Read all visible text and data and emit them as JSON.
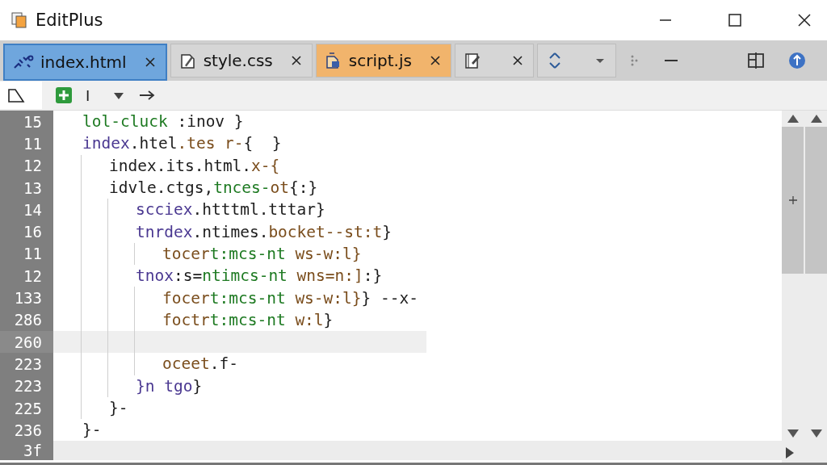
{
  "window": {
    "title": "EditPlus"
  },
  "tabs": [
    {
      "label": "index.html",
      "selected": true,
      "closable": true,
      "color": "#6fa6dd"
    },
    {
      "label": "style.css",
      "selected": false,
      "closable": true,
      "color": "#d6d6d6"
    },
    {
      "label": "script.js",
      "selected": false,
      "closable": true,
      "color": "#f1b46c"
    },
    {
      "selected": false,
      "closable": true,
      "color": "#d6d6d6"
    },
    {
      "selected": false,
      "closable": false,
      "color": "#d6d6d6"
    }
  ],
  "toolbar": {
    "cursor_text": "I"
  },
  "lines": [
    {
      "number": "15",
      "tokens": [
        {
          "text": "lol-cluck ",
          "kind": "value"
        },
        {
          "text": ":inov }",
          "kind": "plain"
        }
      ]
    },
    {
      "number": "11",
      "tokens": [
        {
          "text": "index",
          "kind": "tag"
        },
        {
          "text": ".htel",
          "kind": "plain"
        },
        {
          "text": ".tes r-",
          "kind": "attr"
        },
        {
          "text": "{  }",
          "kind": "plain"
        }
      ],
      "children": [
        {
          "number": "12",
          "tokens": [
            {
              "text": "index.its.html.",
              "kind": "plain"
            },
            {
              "text": "x-{",
              "kind": "attr"
            }
          ]
        },
        {
          "number": "13",
          "tokens": [
            {
              "text": "idvle.ctgs,",
              "kind": "plain"
            },
            {
              "text": "tnces-",
              "kind": "value"
            },
            {
              "text": "ot",
              "kind": "attr"
            },
            {
              "text": "{:}",
              "kind": "plain"
            }
          ],
          "children": [
            {
              "number": "14",
              "tokens": [
                {
                  "text": "scciex",
                  "kind": "tag"
                },
                {
                  "text": ".htttml.tttar}",
                  "kind": "plain"
                }
              ]
            },
            {
              "number": "16",
              "tokens": [
                {
                  "text": "tnrdex",
                  "kind": "tag"
                },
                {
                  "text": ".ntimes.",
                  "kind": "plain"
                },
                {
                  "text": "bocket--st:t",
                  "kind": "attr"
                },
                {
                  "text": "}",
                  "kind": "plain"
                }
              ],
              "children": [
                {
                  "number": "11",
                  "tokens": [
                    {
                      "text": "tocer",
                      "kind": "attr"
                    },
                    {
                      "text": "t:mcs-nt ",
                      "kind": "value"
                    },
                    {
                      "text": "ws-w:l}",
                      "kind": "attr"
                    }
                  ]
                }
              ]
            },
            {
              "number": "12",
              "tokens": [
                {
                  "text": "tnox",
                  "kind": "tag"
                },
                {
                  "text": ":s=",
                  "kind": "plain"
                },
                {
                  "text": "ntimcs-nt ",
                  "kind": "value"
                },
                {
                  "text": "wns=n:]",
                  "kind": "attr"
                },
                {
                  "text": ":}",
                  "kind": "plain"
                }
              ],
              "children": [
                {
                  "number": "133",
                  "tokens": [
                    {
                      "text": "focer",
                      "kind": "attr"
                    },
                    {
                      "text": "t:mcs-nt ",
                      "kind": "value"
                    },
                    {
                      "text": "ws-w:l}",
                      "kind": "attr"
                    },
                    {
                      "text": "} --x-",
                      "kind": "plain"
                    }
                  ]
                },
                {
                  "number": "286",
                  "tokens": [
                    {
                      "text": "foctr",
                      "kind": "attr"
                    },
                    {
                      "text": "t:mcs-nt ",
                      "kind": "value"
                    },
                    {
                      "text": "w:l",
                      "kind": "attr"
                    },
                    {
                      "text": "}",
                      "kind": "plain"
                    }
                  ]
                },
                {
                  "number": "260",
                  "current": true
                },
                {
                  "number": "223",
                  "tokens": [
                    {
                      "text": "oceet",
                      "kind": "attr"
                    },
                    {
                      "text": ".f-",
                      "kind": "plain"
                    }
                  ]
                }
              ]
            },
            {
              "number": "223",
              "tokens": [
                {
                  "text": "}n tgo",
                  "kind": "tag"
                },
                {
                  "text": "}",
                  "kind": "plain"
                }
              ]
            }
          ]
        },
        {
          "number": "225",
          "tokens": [
            {
              "text": "}-",
              "kind": "plain"
            }
          ]
        }
      ]
    },
    {
      "number": "236",
      "tokens": [
        {
          "text": "}-",
          "kind": "plain"
        }
      ]
    },
    {
      "number": "3f"
    }
  ]
}
